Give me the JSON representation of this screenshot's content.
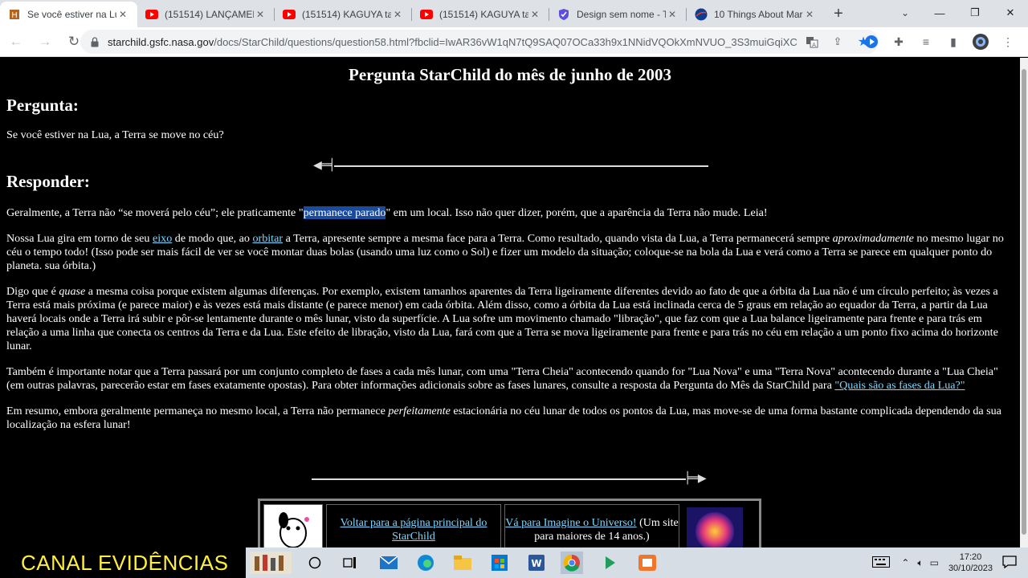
{
  "browser": {
    "tabs": [
      {
        "title": "Se você estiver na Lua",
        "icon": "starchild-favicon",
        "active": true
      },
      {
        "title": "(151514) LANÇAMEN",
        "icon": "youtube-icon",
        "active": false
      },
      {
        "title": "(151514) KAGUYA tak",
        "icon": "youtube-icon",
        "active": false
      },
      {
        "title": "(151514) KAGUYA tak",
        "icon": "youtube-icon",
        "active": false
      },
      {
        "title": "Design sem nome - T",
        "icon": "canva-shield-icon",
        "active": false
      },
      {
        "title": "10 Things About Mar",
        "icon": "nasa-icon",
        "active": false
      }
    ],
    "new_tab_label": "+",
    "url_domain": "starchild.gsfc.nasa.gov",
    "url_path": "/docs/StarChild/questions/question58.html?fbclid=IwAR36vW1qN7tQ9SAQ07OCa33h9x1NNidVQOkXmNVUO_3S3muiGqiXC..."
  },
  "page": {
    "title": "Pergunta StarChild do mês de junho de 2003",
    "question_heading": "Pergunta:",
    "question_text": "Se você estiver na Lua, a Terra se move no céu?",
    "answer_heading": "Responder:",
    "p1_a": "Geralmente, a Terra não “se moverá pelo céu”; ele praticamente \"",
    "p1_hl": "permanece parado",
    "p1_b": "\" em um local. Isso não quer dizer, porém, que a aparência da Terra não mude. Leia!",
    "p2_a": "Nossa Lua gira em torno de seu ",
    "p2_link1": "eixo",
    "p2_b": " de modo que, ao ",
    "p2_link2": "orbitar",
    "p2_c": " a Terra, apresente sempre a mesma face para a Terra. Como resultado, quando vista da Lua, a Terra permanecerá sempre ",
    "p2_em": "aproximadamente",
    "p2_d": " no mesmo lugar no céu o tempo todo! (Isso pode ser mais fácil de ver se você montar duas bolas (usando uma luz como o Sol) e fizer um modelo da situação; coloque-se na bola da Lua e verá como a Terra se parece em qualquer ponto do planeta. sua órbita.)",
    "p3_a": "Digo que é ",
    "p3_em": "quase",
    "p3_b": " a mesma coisa porque existem algumas diferenças. Por exemplo, existem tamanhos aparentes da Terra ligeiramente diferentes devido ao fato de que a órbita da Lua não é um círculo perfeito; às vezes a Terra está mais próxima (e parece maior) e às vezes está mais distante (e parece menor) em cada órbita. Além disso, como a órbita da Lua está inclinada cerca de 5 graus em relação ao equador da Terra, a partir da Lua haverá locais onde a Terra irá subir e pôr-se lentamente durante o mês lunar, visto da superfície. A Lua sofre um movimento chamado \"libração\", que faz com que a Lua balance ligeiramente para frente e para trás em relação a uma linha que conecta os centros da Terra e da Lua. Este efeito de libração, visto da Lua, fará com que a Terra se mova ligeiramente para frente e para trás no céu em relação a um ponto fixo acima do horizonte lunar.",
    "p4_a": "Também é importante notar que a Terra passará por um conjunto completo de fases a cada mês lunar, com uma \"Terra Cheia\" acontecendo quando for \"Lua Nova\" e uma \"Terra Nova\" acontecendo durante a \"Lua Cheia\" (em outras palavras, parecerão estar em fases exatamente opostas). Para obter informações adicionais sobre as fases lunares, consulte a resposta da Pergunta do Mês da StarChild para ",
    "p4_link": "\"Quais são as fases da Lua?\"",
    "p5_a": "Em resumo, embora geralmente permaneça no mesmo local, a Terra não permanece ",
    "p5_em": "perfeitamente",
    "p5_b": " estacionária no céu lunar de todos os pontos da Lua, mas move-se de uma forma bastante complicada dependendo da sua localização na esfera lunar!",
    "footer_link1": "Voltar para a página principal do StarChild",
    "footer_link2": "Vá para Imagine o Universo!",
    "footer_text2": " (Um site para maiores de 14 anos.)"
  },
  "taskbar": {
    "overlay_text": "CANAL EVIDÊNCIAS",
    "time": "17:20",
    "date": "30/10/2023"
  }
}
